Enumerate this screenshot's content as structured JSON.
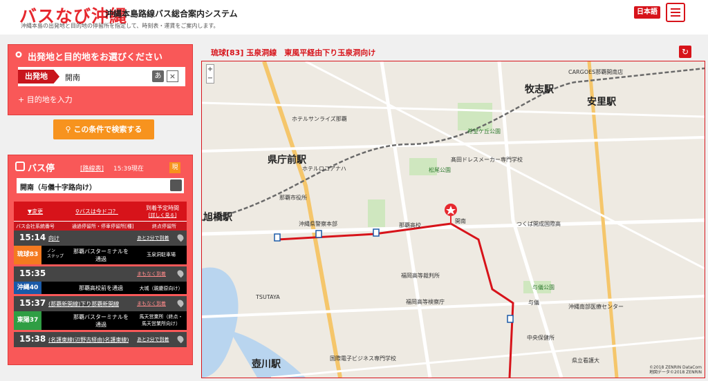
{
  "header": {
    "logo": "バスなび沖縄",
    "subtitle": "沖縄本島路線バス総合案内システム",
    "description": "沖縄本島の出発地と目的地の停留所を指定して、時刻表・運賃をご案内します。",
    "language": "日本語",
    "menu_icon": "hamburger-icon"
  },
  "search": {
    "title": "出発地と目的地をお選びください",
    "origin_label": "出発地",
    "origin_value": "開南",
    "kana_button": "あ",
    "clear_button": "×",
    "destination_link": "目的地を入力",
    "search_button": "この条件で検索する"
  },
  "stop": {
    "title": "バス停",
    "route_map_link": "[路線表]",
    "now_time": "15:39現在",
    "now_badge": "現",
    "stop_name": "開南（与儀十字路向け）",
    "filters": {
      "change": "▼変更",
      "where_now": "バスは今ドコ？",
      "arrival_prediction": "到着予定時間",
      "arrival_details": "[詳しく見る]"
    },
    "columns": {
      "company_route": "バス会社系統番号",
      "via": "通過停留所・停車停留所[種]",
      "terminal": "終点停留所"
    },
    "departures": [
      {
        "time": "15:14",
        "direction": "向け",
        "status": "あと2分で到着",
        "route": "琉球83",
        "color": "#f47a20",
        "via_label": "ノン\nステップ",
        "via": "那覇バスターミナルを\n通過",
        "terminal": "玉泉洞駐車場"
      },
      {
        "time": "15:35",
        "direction": "",
        "status": "まもなく到着",
        "route": "沖縄40",
        "color": "#1a5aa8",
        "via_label": "",
        "via": "那覇高校前を通過",
        "terminal": "大城（親慶原向け）"
      },
      {
        "time": "15:37",
        "direction": "(那覇新開線)下り那覇新開線",
        "status": "まもなく到着",
        "route": "東陽37",
        "color": "#2f9e44",
        "via_label": "",
        "via": "那覇バスターミナルを\n通過",
        "terminal": "馬天営業所（終点・\n馬天営業所向け）"
      },
      {
        "time": "15:38",
        "direction": "(名護東線(辺野古経由)名護東線)",
        "status": "あと2分で到着",
        "route": "",
        "color": "#000000",
        "via_label": "",
        "via": "",
        "terminal": ""
      }
    ]
  },
  "map": {
    "route_title": "琉球[83] 玉泉洞線　東風平経由下り玉泉洞向け",
    "reload_icon": "reload-icon",
    "labels": {
      "kenchomae": "県庁前駅",
      "makishi": "牧志駅",
      "asato": "安里駅",
      "tsubogawa": "壺川駅",
      "asahibashi": "旭橋駅",
      "naha_city_office": "那覇市役所",
      "police": "沖縄県警察本部",
      "fukuoka_court": "福岡高等裁判所",
      "fukuoka_prosecutors": "福岡高等検察庁",
      "yogi_park": "与儀公園",
      "kainan_label": "開南",
      "kibougaoka": "希望ケ丘公園",
      "matsuo_park": "松尾公園",
      "takada": "髙田ドレスメーカー専門学校",
      "tsukuba": "つくば開成国際高",
      "yogi": "与儀",
      "kokusai": "国際電子ビジネス専門学校",
      "tsutaya": "TSUTAYA",
      "naha_high": "那覇高校",
      "central_health": "中央保健所",
      "okinawa_hospital": "沖縄南部医療センター",
      "nurse": "県立看護大",
      "hotel_rocore": "ホテルロコアナハ",
      "hotel_sunrise": "ホテルサンライズ那覇",
      "cargoes": "CARGOES那覇開南店",
      "copyright": "©2018 ZENRIN DataCom\n地図データ©2018 ZENRIN"
    }
  }
}
